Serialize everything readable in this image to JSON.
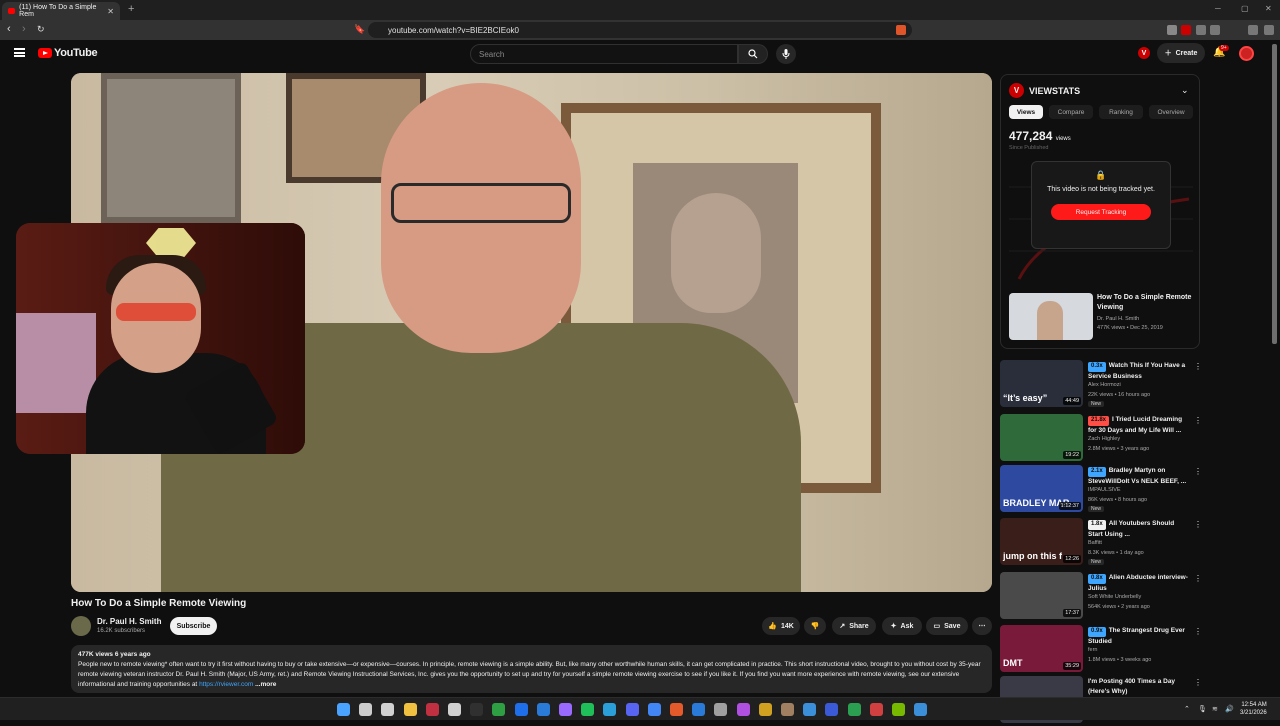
{
  "browser": {
    "tab_title": "(11) How To Do a Simple Rem",
    "url": "youtube.com/watch?v=BIE2BCIEok0",
    "new_tab": "+"
  },
  "header": {
    "logo_text": "YouTube",
    "search_placeholder": "Search",
    "create_label": "Create",
    "notif_count": "9+"
  },
  "video": {
    "title": "How To Do a Simple Remote Viewing",
    "channel": "Dr. Paul H. Smith",
    "subscribers": "16.2K subscribers",
    "subscribe_label": "Subscribe",
    "likes": "14K",
    "share_label": "Share",
    "ask_label": "Ask",
    "save_label": "Save",
    "views_meta": "477K views  6 years ago",
    "description": "People new to remote viewing* often want to try it first without having to buy or take extensive—or expensive—courses. In principle, remote viewing is a simple ability. But, like many other worthwhile human skills, it can get complicated in practice. This short instructional video, brought to you without cost by 35-year remote viewing veteran instructor Dr. Paul H. Smith (Major, US Army, ret.) and Remote Viewing Instructional Services, Inc. gives you the opportunity to set up and try for yourself a simple remote viewing exercise to see if you like it. If you find you want more experience with remote viewing, see our extensive informational and training opportunities at",
    "desc_link": "https://rviewer.com",
    "more": "...more"
  },
  "viewstats": {
    "brand": "VIEWSTATS",
    "tabs": [
      "Views",
      "Compare",
      "Ranking",
      "Overview"
    ],
    "count": "477,284",
    "count_unit": "views",
    "since": "Since Published",
    "not_tracked": "This video is not being tracked yet.",
    "request": "Request Tracking",
    "card_title": "How To Do a Simple Remote Viewing",
    "card_channel": "Dr. Paul H. Smith",
    "card_stats": "477K views • Dec 25, 2019"
  },
  "recs": [
    {
      "mult": "0.3x",
      "mult_color": "#3ea6ff",
      "title": "Watch This If You Have a Service Business",
      "channel": "Alex Hormozi",
      "stats": "22K views • 16 hours ago",
      "new": "New",
      "dur": "44:49",
      "thumb": "#2a2e3a",
      "overlay": "“It’s easy”"
    },
    {
      "mult": "21.8x",
      "mult_color": "#ff4e45",
      "title": "I Tried Lucid Dreaming for 30 Days and My Life Will ...",
      "channel": "Zach Highley",
      "stats": "2.8M views • 3 years ago",
      "new": "",
      "dur": "19:22",
      "thumb": "#2f6b3a",
      "overlay": ""
    },
    {
      "mult": "2.1x",
      "mult_color": "#3ea6ff",
      "title": "Bradley Martyn on SteveWillDoIt Vs NELK BEEF, ...",
      "channel": "IMPAULSIVE",
      "stats": "86K views • 8 hours ago",
      "new": "New",
      "dur": "1:12:37",
      "thumb": "#2e4aa0",
      "overlay": "BRADLEY MAR"
    },
    {
      "mult": "1.8x",
      "mult_color": "#f1f1f1",
      "title": "All Youtubers Should Start Using ...",
      "channel": "Baffitt",
      "stats": "8.3K views • 1 day ago",
      "new": "New",
      "dur": "12:26",
      "thumb": "#3a1e1a",
      "overlay": "jump on this f"
    },
    {
      "mult": "0.8x",
      "mult_color": "#3ea6ff",
      "title": "Alien Abductee interview-Julius",
      "channel": "Soft White Underbelly",
      "stats": "564K views • 2 years ago",
      "new": "",
      "dur": "17:37",
      "thumb": "#4a4a4a",
      "overlay": ""
    },
    {
      "mult": "0.9x",
      "mult_color": "#3ea6ff",
      "title": "The Strangest Drug Ever Studied",
      "channel": "fern",
      "stats": "1.8M views • 3 weeks ago",
      "new": "",
      "dur": "35:29",
      "thumb": "#7a1a3a",
      "overlay": "DMT"
    },
    {
      "mult": "",
      "mult_color": "#3ea6ff",
      "title": "I'm Posting 400 Times a Day (Here's Why)",
      "channel": "",
      "stats": "",
      "new": "",
      "dur": "",
      "thumb": "#3a3a46",
      "overlay": ""
    }
  ],
  "taskbar": {
    "time": "12:54 AM",
    "date": "3/21/2026",
    "icons": [
      "#4aa3ff",
      "#cccccc",
      "#d0d0d0",
      "#f0c040",
      "#c03040",
      "#d0d0d0",
      "#303030",
      "#2ea043",
      "#1f6feb",
      "#2a7ad8",
      "#9a6aff",
      "#1fbf5a",
      "#2a9fd8",
      "#5865f2",
      "#4285f4",
      "#e45a2a",
      "#2a7ad8",
      "#a0a0a0",
      "#b050e0",
      "#d0a020",
      "#a08060",
      "#3a8fd8",
      "#3a5ad8",
      "#2aa050",
      "#d04040",
      "#76b900",
      "#3a8fd8"
    ]
  }
}
